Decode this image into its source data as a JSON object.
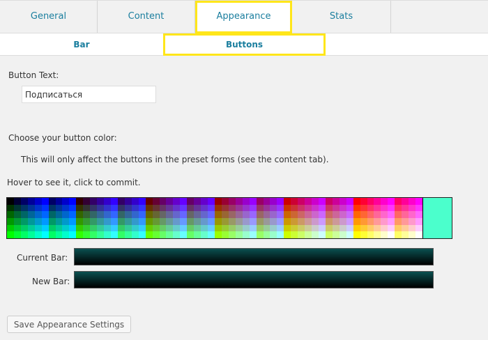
{
  "tabs": [
    {
      "label": "General"
    },
    {
      "label": "Content"
    },
    {
      "label": "Appearance"
    },
    {
      "label": "Stats"
    }
  ],
  "subtabs": [
    {
      "label": "Bar"
    },
    {
      "label": "Buttons"
    }
  ],
  "active_tab": "Appearance",
  "active_subtab": "Buttons",
  "form": {
    "button_text_label": "Button Text:",
    "button_text_value": "Подписаться",
    "choose_color_label": "Choose your button color:",
    "note": "This will only affect the buttons in the preset forms (see the content tab).",
    "hover_hint": "Hover to see it, click to commit.",
    "current_bar_label": "Current Bar:",
    "new_bar_label": "New Bar:",
    "save_button": "Save Appearance Settings"
  },
  "colors": {
    "accent_highlight": "#ffe61a",
    "link": "#1a7e9e",
    "selected_swatch": "#4bffcc",
    "bar_gradient_top": "#0a5050",
    "bar_gradient_bottom": "#000000"
  }
}
